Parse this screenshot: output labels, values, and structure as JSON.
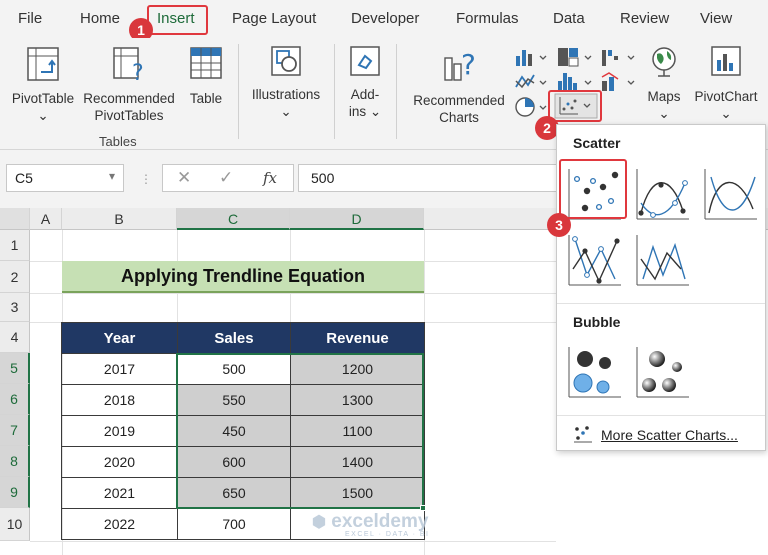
{
  "ribbon_tabs": [
    "File",
    "Home",
    "Insert",
    "Page Layout",
    "Developer",
    "Formulas",
    "Data",
    "Review",
    "View"
  ],
  "active_tab": "Insert",
  "ribbon": {
    "pivottable": "PivotTable",
    "recommended_pivottables_1": "Recommended",
    "recommended_pivottables_2": "PivotTables",
    "table": "Table",
    "tables_group": "Tables",
    "illustrations": "Illustrations",
    "addins_1": "Add-",
    "addins_2": "ins",
    "recommended_charts_1": "Recommended",
    "recommended_charts_2": "Charts",
    "maps": "Maps",
    "pivotchart": "PivotChart"
  },
  "steps": [
    "1",
    "2",
    "3"
  ],
  "formula_bar": {
    "name_box": "C5",
    "fx": "fx",
    "value": "500"
  },
  "grid": {
    "columns": [
      "A",
      "B",
      "C",
      "D"
    ],
    "rows": [
      "1",
      "2",
      "3",
      "4",
      "5",
      "6",
      "7",
      "8",
      "9",
      "10"
    ],
    "title": "Applying Trendline Equation",
    "headers": [
      "Year",
      "Sales",
      "Revenue"
    ],
    "data": [
      [
        "2017",
        "500",
        "1200"
      ],
      [
        "2018",
        "550",
        "1300"
      ],
      [
        "2019",
        "450",
        "1100"
      ],
      [
        "2020",
        "600",
        "1400"
      ],
      [
        "2021",
        "650",
        "1500"
      ],
      [
        "2022",
        "700",
        ""
      ]
    ]
  },
  "dropdown": {
    "scatter_heading": "Scatter",
    "bubble_heading": "Bubble",
    "more_link": "More Scatter Charts..."
  },
  "watermark": {
    "brand": "exceldemy",
    "tagline": "EXCEL · DATA · BI"
  },
  "colors": {
    "accent_green": "#217346",
    "title_fill": "#c6e0b4",
    "header_fill": "#203864",
    "highlight_red": "#e0383e",
    "shaded_cell": "#cfcfcf"
  }
}
